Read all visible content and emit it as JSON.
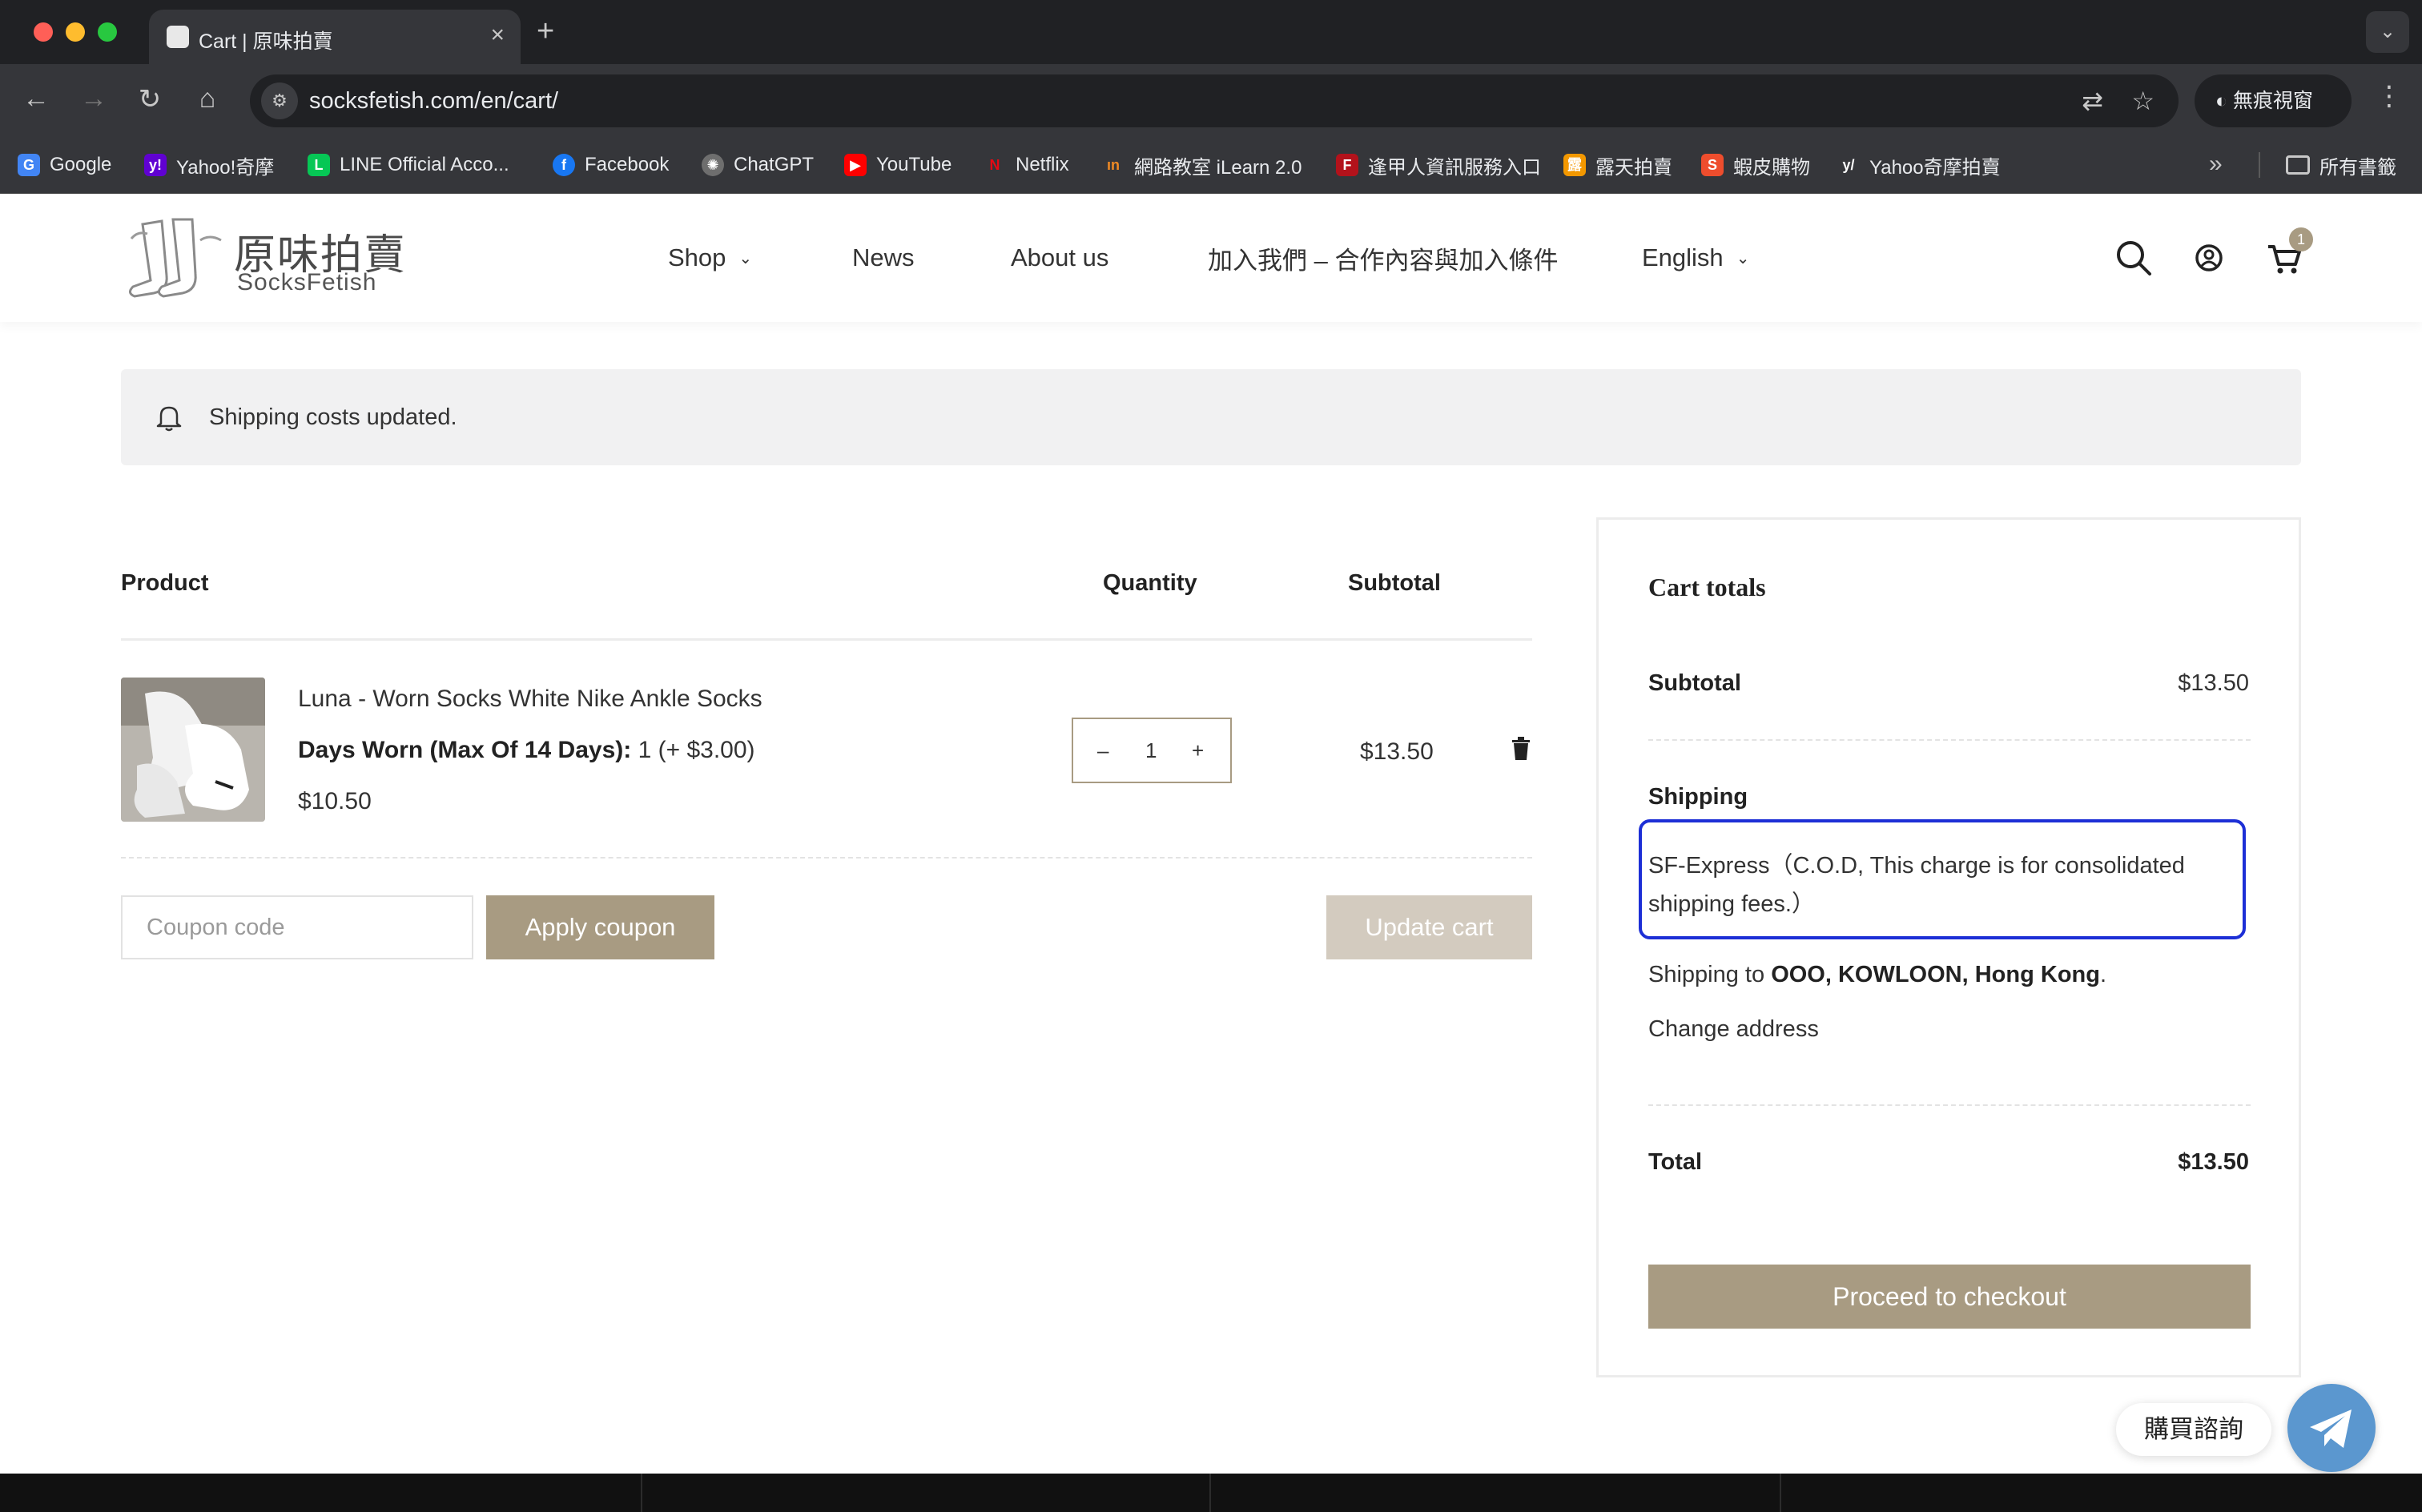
{
  "browser": {
    "tab_title": "Cart | 原味拍賣",
    "url": "socksfetish.com/en/cart/",
    "incognito_label": "無痕視窗",
    "bookmarks": [
      {
        "label": "Google",
        "icon": "google-icon",
        "color": "#4285f4"
      },
      {
        "label": "Yahoo!奇摩",
        "icon": "yahoo-icon",
        "color": "#6001d2"
      },
      {
        "label": "LINE Official Acco...",
        "icon": "line-icon",
        "color": "#06c755"
      },
      {
        "label": "Facebook",
        "icon": "facebook-icon",
        "color": "#1877f2"
      },
      {
        "label": "ChatGPT",
        "icon": "chatgpt-icon",
        "color": "#9a9a9a"
      },
      {
        "label": "YouTube",
        "icon": "youtube-icon",
        "color": "#ff0000"
      },
      {
        "label": "Netflix",
        "icon": "netflix-icon",
        "color": "#e50914"
      },
      {
        "label": "網路教室 iLearn 2.0",
        "icon": "ilearn-icon",
        "color": "#f08a24"
      },
      {
        "label": "逢甲人資訊服務入口",
        "icon": "fcu-icon",
        "color": "#b3121b"
      },
      {
        "label": "露天拍賣",
        "icon": "ruten-icon",
        "color": "#f39800"
      },
      {
        "label": "蝦皮購物",
        "icon": "shopee-icon",
        "color": "#ee4d2d"
      },
      {
        "label": "Yahoo奇摩拍賣",
        "icon": "yahoo-auction-icon",
        "color": "#6001d2"
      }
    ],
    "all_bookmarks_label": "所有書籤"
  },
  "site": {
    "logo_cn": "原味拍賣",
    "logo_en": "SocksFetish",
    "nav": {
      "shop": "Shop",
      "news": "News",
      "about": "About us",
      "join": "加入我們 – 合作內容與加入條件",
      "language": "English"
    },
    "cart_count": "1"
  },
  "notice": "Shipping costs updated.",
  "cart": {
    "headers": {
      "product": "Product",
      "quantity": "Quantity",
      "subtotal": "Subtotal"
    },
    "item": {
      "name": "Luna - Worn Socks White Nike Ankle Socks",
      "meta_label": "Days Worn (Max Of 14 Days):",
      "meta_value": "1 (+ $3.00)",
      "price": "$10.50",
      "qty": "1",
      "qty_minus": "–",
      "qty_plus": "+",
      "subtotal": "$13.50"
    },
    "coupon_placeholder": "Coupon code",
    "apply_label": "Apply coupon",
    "update_label": "Update cart"
  },
  "totals": {
    "title": "Cart totals",
    "subtotal_label": "Subtotal",
    "subtotal_value": "$13.50",
    "shipping_label": "Shipping",
    "shipping_method": "SF-Express（C.O.D, This charge is for consolidated shipping fees.）",
    "shipping_to_prefix": "Shipping to",
    "shipping_to_address": "OOO, KOWLOON, Hong Kong",
    "shipping_to_suffix": ".",
    "change_address": "Change address",
    "total_label": "Total",
    "total_value": "$13.50",
    "checkout_label": "Proceed to checkout"
  },
  "chat": {
    "label": "購買諮詢"
  },
  "colors": {
    "accent": "#a89b82",
    "highlight": "#1d2fd6"
  }
}
